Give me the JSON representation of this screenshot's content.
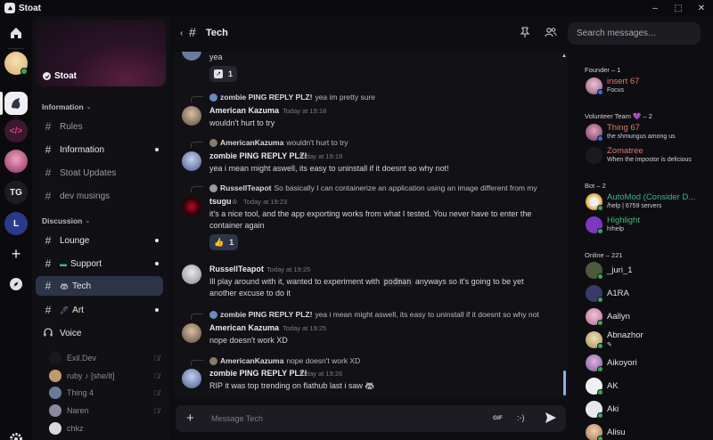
{
  "app": {
    "name": "Stoat"
  },
  "window_controls": {
    "minimize": "–",
    "maximize": "⬚",
    "close": "✕"
  },
  "rail": {
    "items": [
      {
        "name": "home",
        "label": ""
      },
      {
        "name": "avatar",
        "label": ""
      },
      {
        "name": "stoat-server",
        "label": ""
      },
      {
        "name": "dev-server",
        "label": "</>"
      },
      {
        "name": "anime-server",
        "label": ""
      },
      {
        "name": "tg-server",
        "label": "TG"
      },
      {
        "name": "l-server",
        "label": "L"
      },
      {
        "name": "add-server",
        "label": "+"
      },
      {
        "name": "discover",
        "label": ""
      }
    ]
  },
  "server": {
    "name": "Stoat",
    "categories": {
      "information": "Information",
      "discussion": "Discussion"
    },
    "channels_info": [
      {
        "label": "Rules",
        "unread": false
      },
      {
        "label": "Information",
        "unread": true
      },
      {
        "label": "Stoat Updates",
        "unread": false
      },
      {
        "label": "dev musings",
        "unread": false
      }
    ],
    "channels_discussion": [
      {
        "label": "Lounge",
        "emoji": "",
        "unread": true
      },
      {
        "label": "Support",
        "emoji": "▬",
        "unread": true
      },
      {
        "label": "Tech",
        "emoji": "🦝",
        "unread": false
      },
      {
        "label": "Art",
        "emoji": "🖊",
        "unread": true
      },
      {
        "label": "Voice",
        "emoji": "",
        "unread": false
      }
    ],
    "voice_users": [
      {
        "name": "Exil.Dev"
      },
      {
        "name": "ruby ♪ [she/it]"
      },
      {
        "name": "Thing 4"
      },
      {
        "name": "Naren"
      },
      {
        "name": "chkz"
      }
    ]
  },
  "channel": {
    "name": "Tech"
  },
  "messages": [
    {
      "text": "yea",
      "reaction": {
        "emoji": "↗",
        "count": "1"
      }
    },
    {
      "reply_author": "zombie PING REPLY PLZ!",
      "reply_text": "yea im pretty sure",
      "author": "American Kazuma",
      "time": "Today at 19:18",
      "text": "wouldn't hurt to try"
    },
    {
      "reply_author": "AmericanKazuma",
      "reply_text": "wouldn't hurt to try",
      "author": "zombie PING REPLY PLZ!",
      "time": "Today at 19:19",
      "text": "yea i mean might aswell, its easy to uninstall if it doesnt so why not!"
    },
    {
      "reply_author": "RussellTeapot",
      "reply_text": "So basically I can containerize an application using an image different from my",
      "author": "tsugu",
      "badge": "♔",
      "time": "Today at 19:23",
      "text": "it's a nice tool, and the app exporting works from what I tested. You never have to enter the",
      "text2": "container again",
      "reaction": {
        "emoji": "👍",
        "count": "1"
      }
    },
    {
      "author": "RussellTeapot",
      "time": "Today at 19:25",
      "text_before": "Ill play around with it, wanted to experiment with ",
      "code": "podman",
      "text_after": " anyways so it's going to be yet",
      "text2": "another excuse to do it"
    },
    {
      "reply_author": "zombie PING REPLY PLZ!",
      "reply_text": "yea i mean might aswell, its easy to uninstall if it doesnt so why not",
      "author": "American Kazuma",
      "time": "Today at 19:25",
      "text": "nope doesn't work XD"
    },
    {
      "reply_author": "AmericanKazuma",
      "reply_text": "nope doesn't work XD",
      "author": "zombie PING REPLY PLZ!",
      "time": "Today at 19:26",
      "text": "RIP it was top trending on flathub last i saw 🦝"
    }
  ],
  "composer": {
    "placeholder": "Message Tech",
    "gif": "GIF",
    "emoji": ":-)"
  },
  "search": {
    "placeholder": "Search messages..."
  },
  "member_groups": {
    "founder": "Founder – 1",
    "volunteer": "Volunteer Team 💜 – 2",
    "bot": "Bot – 2",
    "online": "Online – 221"
  },
  "members": {
    "founder": [
      {
        "name": "insert 67",
        "status": "Focus",
        "color": "#e0786a"
      }
    ],
    "volunteer": [
      {
        "name": "Thing 67",
        "status": "the shmungus among us",
        "color": "#e0786a"
      },
      {
        "name": "Zomatree",
        "status": "When the impostor is delicious",
        "color": "#e0786a"
      }
    ],
    "bot": [
      {
        "name": "AutoMod (Consider D...",
        "status": "/help | 6759 servers",
        "color": "#43b581"
      },
      {
        "name": "Highlight",
        "status": "h!help",
        "color": "#43b581"
      }
    ],
    "online": [
      {
        "name": "_juri_1",
        "status": ""
      },
      {
        "name": "A1RA",
        "status": ""
      },
      {
        "name": "Aallyn",
        "status": ""
      },
      {
        "name": "Abnazhor",
        "status": "✎"
      },
      {
        "name": "Aikoyori",
        "status": ""
      },
      {
        "name": "AK",
        "status": ""
      },
      {
        "name": "Aki",
        "status": ""
      },
      {
        "name": "Alisu",
        "status": ""
      }
    ]
  }
}
